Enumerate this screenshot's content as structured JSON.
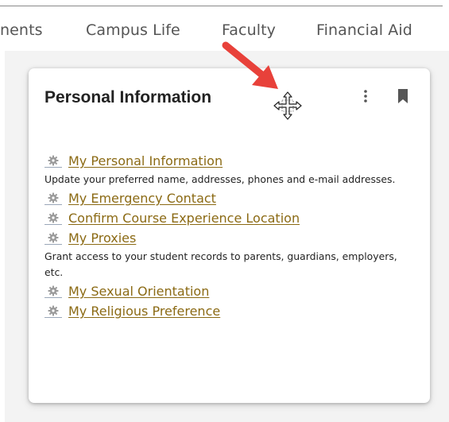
{
  "nav": {
    "items": [
      {
        "label": "nents"
      },
      {
        "label": "Campus Life"
      },
      {
        "label": "Faculty"
      },
      {
        "label": "Financial Aid"
      }
    ]
  },
  "card": {
    "title": "Personal Information",
    "menu_icon": "kebab-menu-icon",
    "bookmark_icon": "bookmark-icon",
    "links": [
      {
        "label": "My Personal Information",
        "description": "Update your preferred name, addresses, phones and e-mail addresses."
      },
      {
        "label": "My Emergency Contact"
      },
      {
        "label": "Confirm Course Experience Location"
      },
      {
        "label": "My Proxies",
        "description": "Grant access to your student records to parents, guardians, employers, etc."
      },
      {
        "label": "My Sexual Orientation"
      },
      {
        "label": "My Religious Preference"
      }
    ]
  },
  "overlay": {
    "arrow_color": "#e8413a",
    "cursor": "move-cursor-icon"
  },
  "colors": {
    "link": "#8b6a14",
    "gear": "#9b9b9b",
    "nav_text": "#555555",
    "background": "#f3f3f3"
  }
}
